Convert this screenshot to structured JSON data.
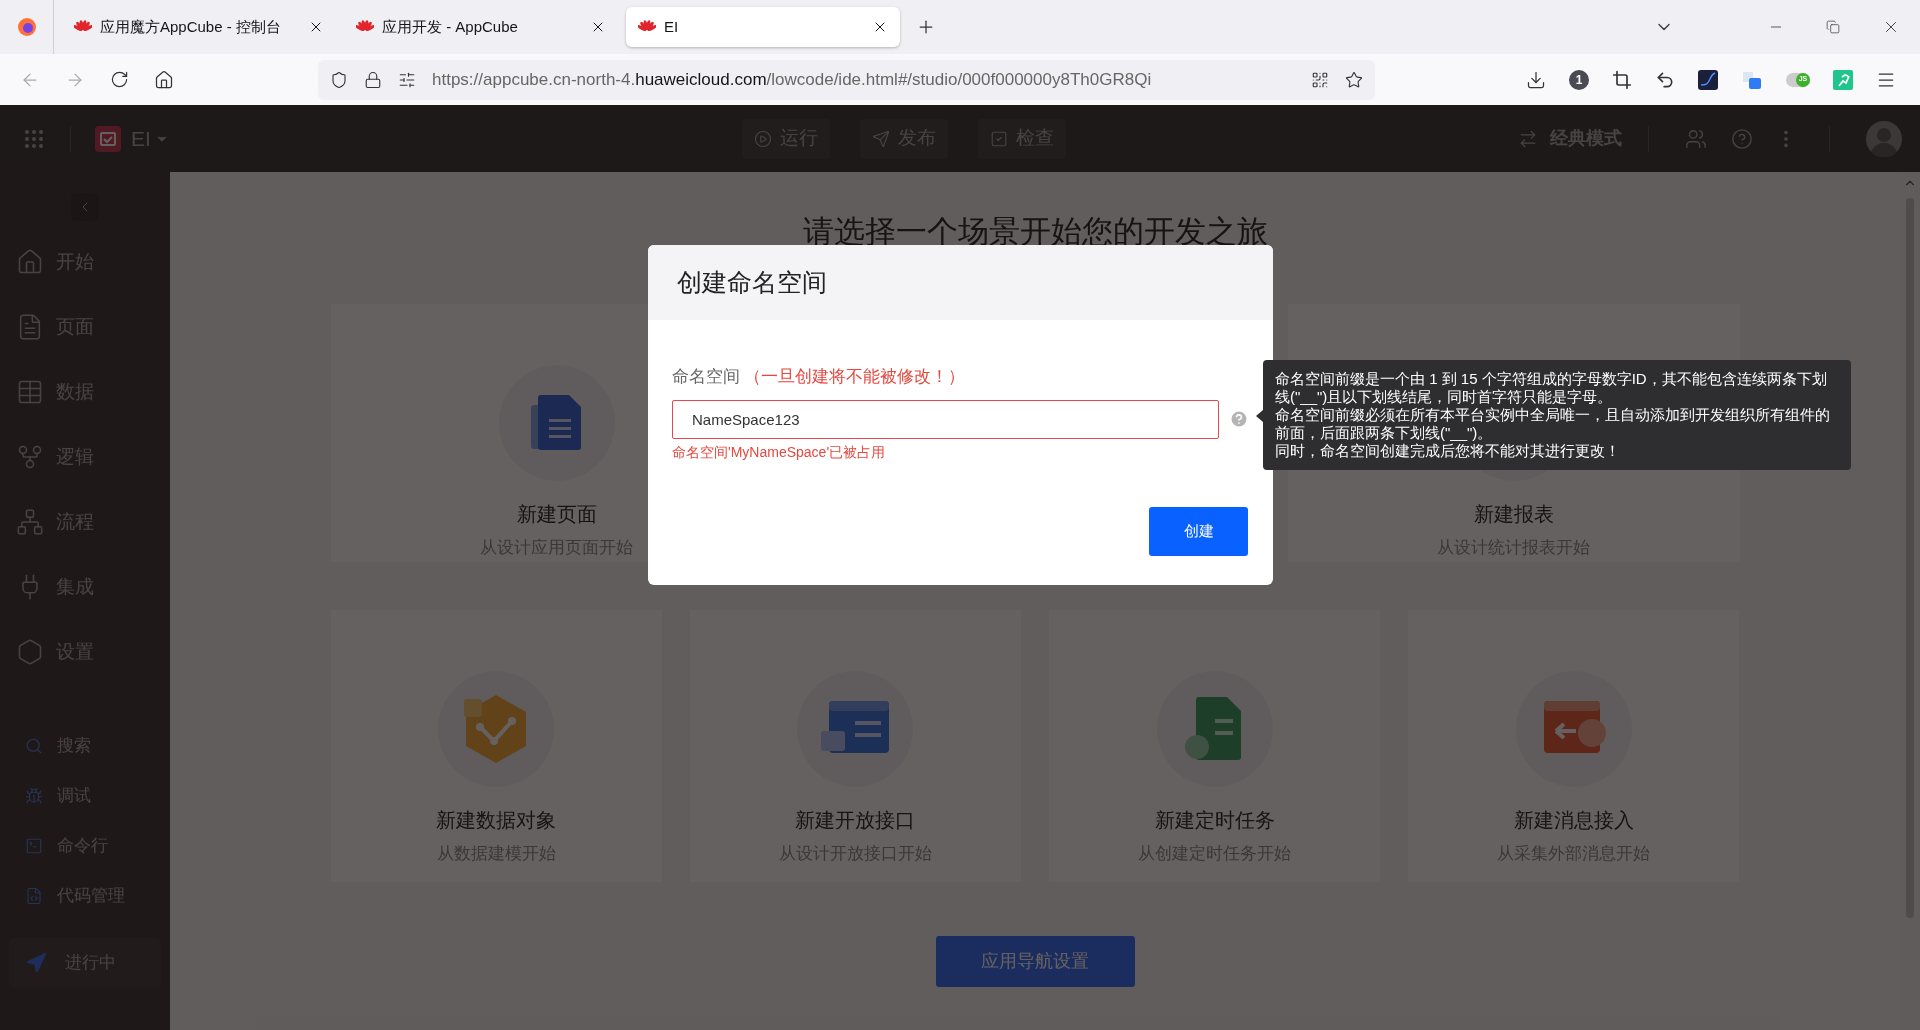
{
  "browser": {
    "tabs": [
      {
        "title": "应用魔方AppCube - 控制台",
        "selected": false
      },
      {
        "title": "应用开发 - AppCube",
        "selected": false
      },
      {
        "title": "EI",
        "selected": true
      }
    ],
    "url": {
      "start": "https://appcube.cn-north-4.",
      "domain": "huaweicloud.com",
      "rest": "/lowcode/ide.html#/studio/000f000000y8Th0GR8Qi"
    },
    "extension_badge": "1",
    "js_badge": "JS"
  },
  "header": {
    "app_name": "EI",
    "actions": [
      {
        "label": "运行",
        "kind": "run"
      },
      {
        "label": "发布",
        "kind": "publish"
      },
      {
        "label": "检查",
        "kind": "check"
      }
    ],
    "mode": "经典模式"
  },
  "sidebar": {
    "items": [
      {
        "label": "开始",
        "kind": "home"
      },
      {
        "label": "页面",
        "kind": "page"
      },
      {
        "label": "数据",
        "kind": "data"
      },
      {
        "label": "逻辑",
        "kind": "logic"
      },
      {
        "label": "流程",
        "kind": "flow"
      },
      {
        "label": "集成",
        "kind": "plug"
      },
      {
        "label": "设置",
        "kind": "settings"
      }
    ],
    "tools": [
      {
        "label": "搜索",
        "kind": "search"
      },
      {
        "label": "调试",
        "kind": "debug"
      },
      {
        "label": "命令行",
        "kind": "terminal"
      },
      {
        "label": "代码管理",
        "kind": "code"
      }
    ],
    "running": "进行中"
  },
  "main": {
    "heading": "请选择一个场景开始您的开发之旅",
    "top_cards": [
      {
        "title": "新建页面",
        "subtitle": "从设计应用页面开始",
        "kind": "page"
      },
      {
        "title": "新建报表",
        "subtitle": "从设计统计报表开始"
      }
    ],
    "bottom_cards": [
      {
        "title": "新建数据对象",
        "subtitle": "从数据建模开始",
        "kind": "object"
      },
      {
        "title": "新建开放接口",
        "subtitle": "从设计开放接口开始",
        "kind": "api"
      },
      {
        "title": "新建定时任务",
        "subtitle": "从创建定时任务开始",
        "kind": "task"
      },
      {
        "title": "新建消息接入",
        "subtitle": "从采集外部消息开始",
        "kind": "message"
      }
    ],
    "nav_button": "应用导航设置"
  },
  "dialog": {
    "title": "创建命名空间",
    "field_label": "命名空间",
    "warning": "（一旦创建将不能被修改！）",
    "value": "NameSpace123",
    "error": "命名空间'MyNameSpace'已被占用",
    "submit": "创建",
    "tooltip": [
      "命名空间前缀是一个由 1 到 15 个字符组成的字母数字ID，其不能包含连续两条下划线(\"__\")且以下划线结尾，同时首字符只能是字母。",
      "命名空间前缀必须在所有本平台实例中全局唯一，且自动添加到开发组织所有组件的前面，后面跟两条下划线(\"__\")。",
      "同时，命名空间创建完成后您将不能对其进行更改！"
    ]
  }
}
